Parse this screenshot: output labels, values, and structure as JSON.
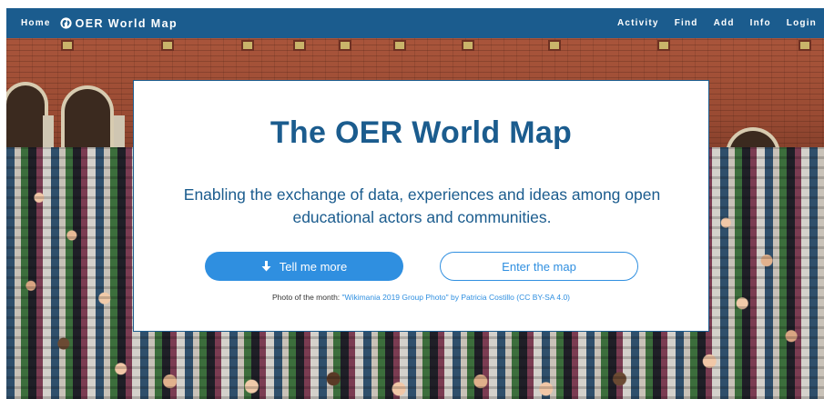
{
  "nav": {
    "home": "Home",
    "brand": "OER World Map",
    "brand_icon": "globe-icon",
    "items": [
      "Activity",
      "Find",
      "Add",
      "Info",
      "Login"
    ]
  },
  "hero": {
    "title": "The OER World Map",
    "subtitle": "Enabling the exchange of data, experiences and ideas among open educational actors and communities.",
    "primary_button": "Tell me more",
    "primary_button_icon": "arrow-down-icon",
    "secondary_button": "Enter the map",
    "credit_prefix": "Photo of the month: ",
    "credit_link_title": "\"Wikimania 2019 Group Photo\"",
    "credit_by": " by ",
    "credit_author": "Patricia Costillo",
    "credit_license": "(CC BY-SA 4.0)"
  },
  "colors": {
    "brand_blue": "#1b5c8e",
    "accent_blue": "#2f8fe0"
  }
}
